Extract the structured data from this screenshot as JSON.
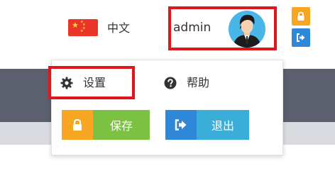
{
  "header": {
    "language": {
      "flag_icon": "china-flag-icon",
      "label": "中文"
    },
    "user": {
      "name": "admin",
      "avatar_icon": "user-avatar-icon"
    },
    "side_buttons": [
      {
        "icon": "lock-icon",
        "color": "#f6a623"
      },
      {
        "icon": "sign-out-icon",
        "color": "#2f87d8"
      }
    ]
  },
  "dropdown": {
    "settings": {
      "icon": "gear-icon",
      "label": "设置"
    },
    "help": {
      "icon": "question-circle-icon",
      "label": "帮助"
    },
    "save": {
      "icon": "lock-icon",
      "label": "保存",
      "icon_color": "#f6a623",
      "color": "#7cc242"
    },
    "logout": {
      "icon": "sign-out-icon",
      "label": "退出",
      "icon_color": "#2f87d8",
      "color": "#3aaed8"
    }
  },
  "colors": {
    "highlight": "#e0151e",
    "backdrop_dark": "#5c5f6e"
  }
}
